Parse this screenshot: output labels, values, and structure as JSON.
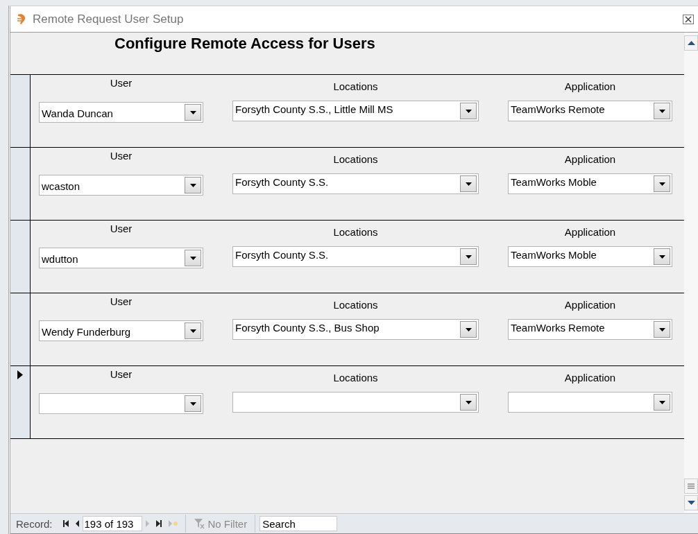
{
  "window": {
    "title": "Remote Request User Setup"
  },
  "form": {
    "heading": "Configure Remote Access for Users"
  },
  "records": [
    {
      "current": false,
      "user_label": "User",
      "user": "Wanda Duncan",
      "locations_label": "Locations",
      "locations": "Forsyth County S.S., Little Mill MS",
      "application_label": "Application",
      "application": "TeamWorks Remote"
    },
    {
      "current": false,
      "user_label": "User",
      "user": "wcaston",
      "locations_label": "Locations",
      "locations": "Forsyth County S.S.",
      "application_label": "Application",
      "application": "TeamWorks Moble"
    },
    {
      "current": false,
      "user_label": "User",
      "user": "wdutton",
      "locations_label": "Locations",
      "locations": "Forsyth County S.S.",
      "application_label": "Application",
      "application": "TeamWorks Moble"
    },
    {
      "current": false,
      "user_label": "User",
      "user": "Wendy Funderburg",
      "locations_label": "Locations",
      "locations": "Forsyth County S.S., Bus Shop",
      "application_label": "Application",
      "application": "TeamWorks Remote"
    },
    {
      "current": true,
      "user_label": "User",
      "locations_label": "Locations",
      "application_label": "Application"
    }
  ],
  "navigation": {
    "label": "Record:",
    "position": "193 of 193",
    "filter": "No Filter",
    "search": {
      "placeholder": "Search"
    }
  }
}
